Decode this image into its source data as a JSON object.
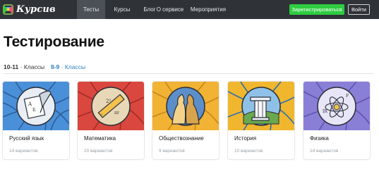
{
  "header": {
    "logo_text": "Курсив",
    "nav": [
      {
        "label": "Тесты",
        "active": true
      },
      {
        "label": "Курсы",
        "active": false
      },
      {
        "label": "Блог",
        "active": false
      },
      {
        "label": "О сервисе",
        "active": false
      },
      {
        "label": "Мероприятия",
        "active": false
      }
    ],
    "register_label": "Зарегистрироваться",
    "login_label": "Войти"
  },
  "page": {
    "title": "Тестирование",
    "tabs": [
      {
        "grade": "10-11",
        "suffix": " · Классы",
        "selected": true
      },
      {
        "grade": "8-9",
        "suffix": " · Классы",
        "selected": false
      }
    ]
  },
  "cards": [
    {
      "name": "Русский язык",
      "variants": "14 вариантов",
      "bg": "#4a90d9",
      "icon": "pen-and-paper-icon"
    },
    {
      "name": "Математика",
      "variants": "20 вариантов",
      "bg": "#d9473e",
      "icon": "ruler-and-formulas-icon"
    },
    {
      "name": "Обществознание",
      "variants": "9 вариантов",
      "bg": "#f2b234",
      "icon": "faces-icon"
    },
    {
      "name": "История",
      "variants": "10 вариантов",
      "bg": "#f0b62e",
      "icon": "column-icon"
    },
    {
      "name": "Физика",
      "variants": "14 вариантов",
      "bg": "#8a7fd6",
      "icon": "atom-icon"
    }
  ],
  "colors": {
    "topbar": "#2f3338",
    "register_btn": "#2ecc40",
    "link_blue": "#2d7fc1"
  }
}
